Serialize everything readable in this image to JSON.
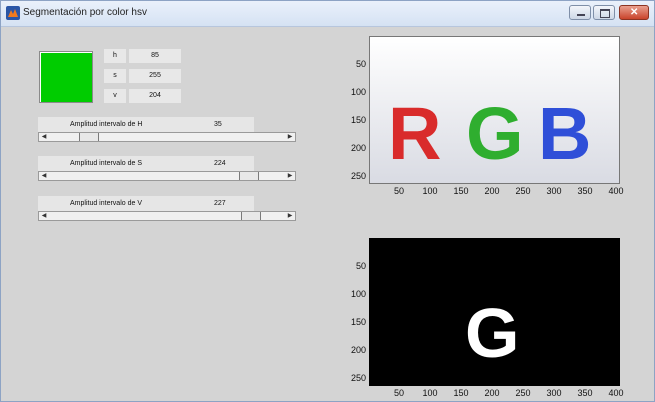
{
  "window": {
    "title": "Segmentación por color hsv"
  },
  "color_preview": "#00cc00",
  "hsv": [
    {
      "label": "h",
      "value": "85"
    },
    {
      "label": "s",
      "value": "255"
    },
    {
      "label": "v",
      "value": "204"
    }
  ],
  "sliders": [
    {
      "label": "Amplitud intervalo de H",
      "value": "35",
      "level": 0.14
    },
    {
      "label": "Amplitud intervalo de S",
      "value": "224",
      "level": 0.88
    },
    {
      "label": "Amplitud intervalo de V",
      "value": "227",
      "level": 0.89
    }
  ],
  "axes_top": {
    "yticks": [
      "50",
      "100",
      "150",
      "200",
      "250"
    ],
    "xticks": [
      "50",
      "100",
      "150",
      "200",
      "250",
      "300",
      "350",
      "400"
    ],
    "image_letters": [
      "R",
      "G",
      "B"
    ],
    "letter_colors": [
      "#d92b2b",
      "#2fae2f",
      "#2f4fd8"
    ]
  },
  "axes_bottom": {
    "yticks": [
      "50",
      "100",
      "150",
      "200",
      "250"
    ],
    "xticks": [
      "50",
      "100",
      "150",
      "200",
      "250",
      "300",
      "350",
      "400"
    ],
    "mask_letter": "G"
  },
  "icons": [
    "app-icon",
    "minimize-icon",
    "maximize-icon",
    "close-icon",
    "left-arrow-icon",
    "right-arrow-icon"
  ]
}
